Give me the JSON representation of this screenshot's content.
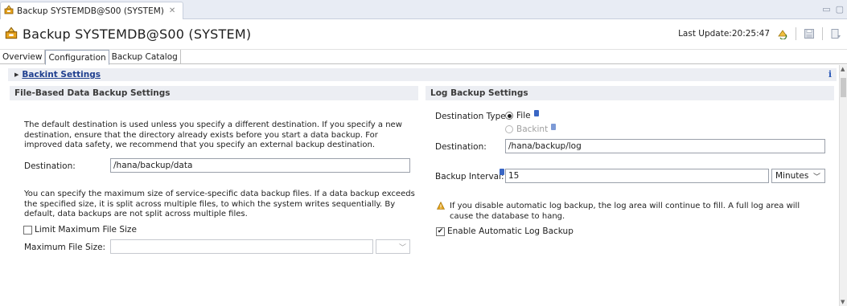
{
  "editor_tab": {
    "title": "Backup SYSTEMDB@S00 (SYSTEM)"
  },
  "header": {
    "title": "Backup SYSTEMDB@S00 (SYSTEM)",
    "last_update": "Last Update:20:25:47"
  },
  "tabs": [
    {
      "label": "Overview",
      "active": false
    },
    {
      "label": "Configuration",
      "active": true
    },
    {
      "label": "Backup Catalog",
      "active": false
    }
  ],
  "backint": {
    "label": "Backint Settings"
  },
  "file_based": {
    "heading": "File-Based Data Backup Settings",
    "description": "The default destination is used unless you specify a different destination. If you specify a new destination, ensure that the directory already exists before you start a data backup. For improved data safety, we recommend that you specify an external backup destination.",
    "destination_label": "Destination:",
    "destination_value": "/hana/backup/data",
    "size_description": "You can specify the maximum size of service-specific data backup files. If a data backup exceeds the specified size, it is split across multiple files, to which the system writes sequentially. By default, data backups are not split across multiple files.",
    "limit_checkbox_label": "Limit Maximum File Size",
    "limit_checked": false,
    "max_size_label": "Maximum File Size:",
    "max_size_value": "",
    "max_size_unit": ""
  },
  "log_backup": {
    "heading": "Log Backup Settings",
    "destination_type_label": "Destination Type:",
    "option_file": "File",
    "option_backint": "Backint",
    "selected_option": "File",
    "destination_label": "Destination:",
    "destination_value": "/hana/backup/log",
    "interval_label": "Backup Interval:",
    "interval_value": "15",
    "interval_unit": "Minutes",
    "warning": "If you disable automatic log backup, the log area will continue to fill. A full log area will cause the database to hang.",
    "enable_label": "Enable Automatic Log Backup",
    "enable_checked": true
  },
  "colors": {
    "section_bg": "#eceef3",
    "link": "#1f3f8f",
    "warning": "#e3a21a"
  }
}
